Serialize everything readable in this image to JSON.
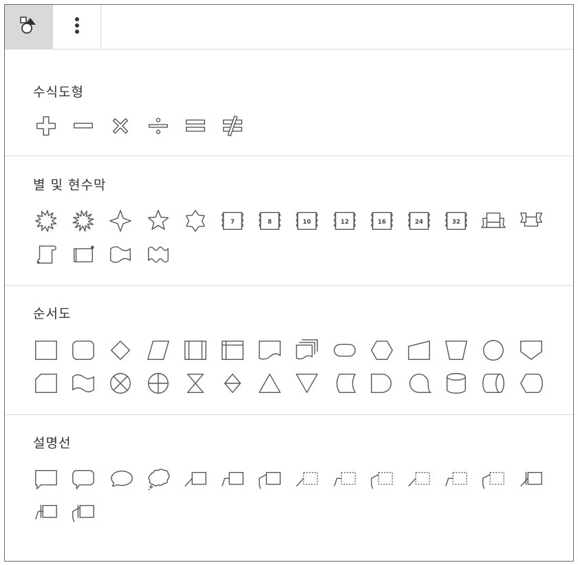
{
  "tabs": [
    {
      "name": "shapes-tab",
      "icon": "shapes-icon"
    },
    {
      "name": "more-options-tab",
      "icon": "vertical-ellipsis-icon"
    }
  ],
  "sections": [
    {
      "title": "수식도형",
      "shapes": [
        "plus",
        "minus",
        "multiply",
        "divide",
        "equal",
        "not-equal"
      ]
    },
    {
      "title": "별 및 현수막",
      "shapes": [
        "explosion-1",
        "explosion-2",
        "star-4",
        "star-5",
        "star-6",
        "star-7",
        "star-8",
        "star-10",
        "star-12",
        "star-16",
        "star-24",
        "star-32",
        "ribbon-down",
        "ribbon-up",
        "scroll-vertical",
        "scroll-horizontal",
        "wave",
        "double-wave"
      ],
      "labels": {
        "star-7": "7",
        "star-8": "8",
        "star-10": "10",
        "star-12": "12",
        "star-16": "16",
        "star-24": "24",
        "star-32": "32"
      }
    },
    {
      "title": "순서도",
      "shapes": [
        "process",
        "alternate-process",
        "decision",
        "data",
        "predefined-process",
        "internal-storage",
        "document",
        "multidocument",
        "terminator",
        "preparation",
        "manual-input",
        "manual-operation",
        "connector",
        "off-page-connector",
        "punched-card",
        "punched-tape",
        "summing-junction",
        "or",
        "collate",
        "sort",
        "extract",
        "merge",
        "stored-data",
        "delay",
        "sequential-access-storage",
        "magnetic-disk",
        "direct-access-storage",
        "display"
      ]
    },
    {
      "title": "설명선",
      "shapes": [
        "rectangular-callout",
        "rounded-rectangular-callout",
        "oval-callout",
        "cloud-callout",
        "line-callout-1",
        "line-callout-2",
        "line-callout-3",
        "line-callout-1-no-border",
        "line-callout-2-no-border",
        "line-callout-3-no-border",
        "line-callout-1-accent",
        "line-callout-2-accent",
        "line-callout-3-accent",
        "line-callout-1-border-accent",
        "line-callout-2-border-accent",
        "line-callout-3-border-accent"
      ]
    }
  ],
  "colors": {
    "stroke": "#555555",
    "tab_active": "#d9d9d9",
    "divider": "#d9d9d9"
  }
}
